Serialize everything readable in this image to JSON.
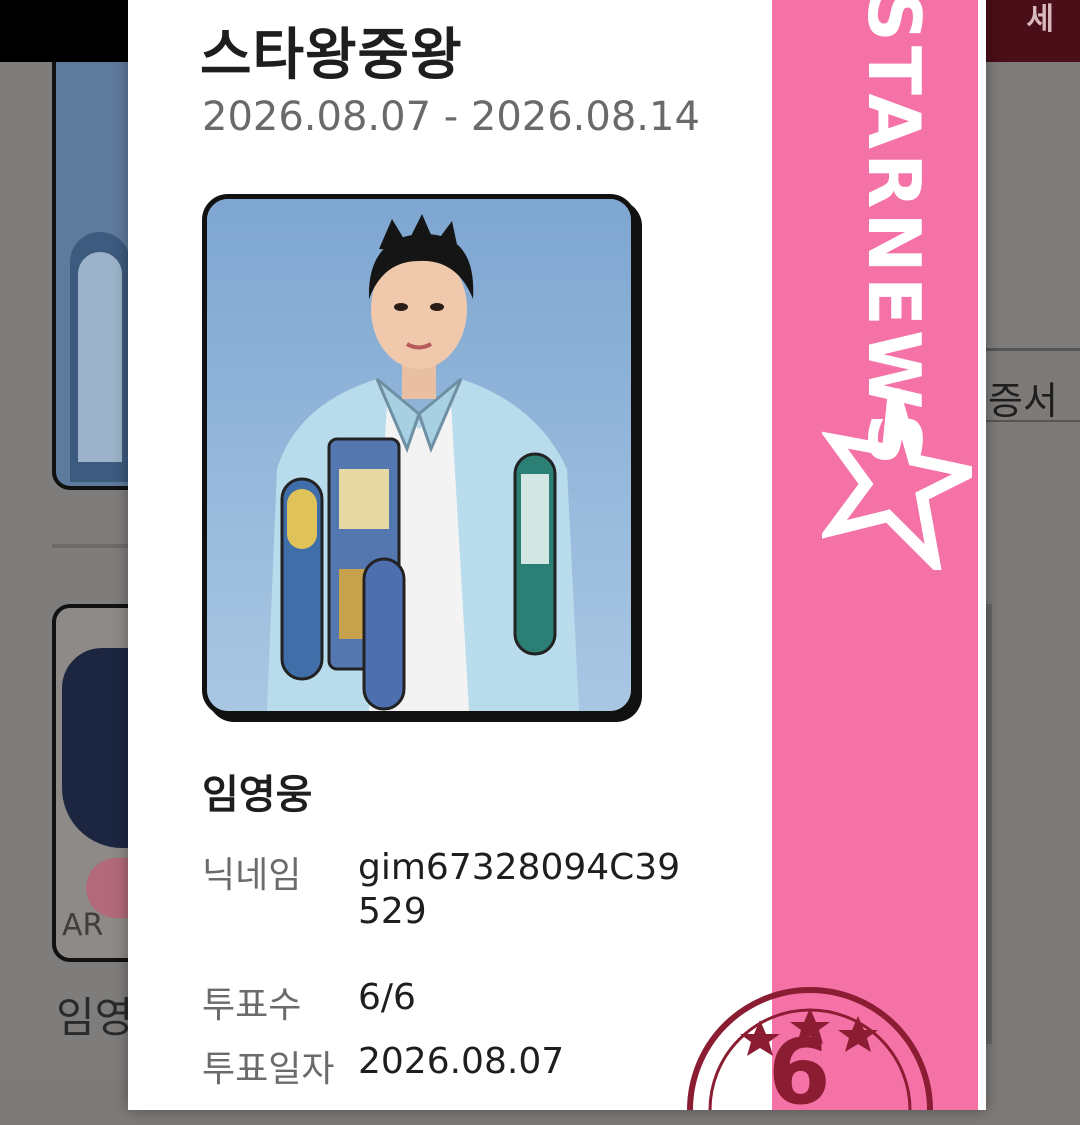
{
  "background": {
    "topbar_button_label": "세",
    "right_panel_label": "증서",
    "card_badge_label": "AR",
    "list_item_name": "임영"
  },
  "modal": {
    "title": "스타왕중왕",
    "period": "2026.08.07 - 2026.08.14",
    "artist_name": "임영웅",
    "fields": [
      {
        "label": "닉네임",
        "value": "gim67328094C39529"
      },
      {
        "label": "투표수",
        "value": "6/6"
      },
      {
        "label": "투표일자",
        "value": "2026.08.07"
      }
    ],
    "ribbon_text": "STARNEWS",
    "stamp_number": "6"
  },
  "colors": {
    "ribbon": "#f472a6",
    "stamp": "#8b1d33",
    "topbar": "#000000"
  }
}
